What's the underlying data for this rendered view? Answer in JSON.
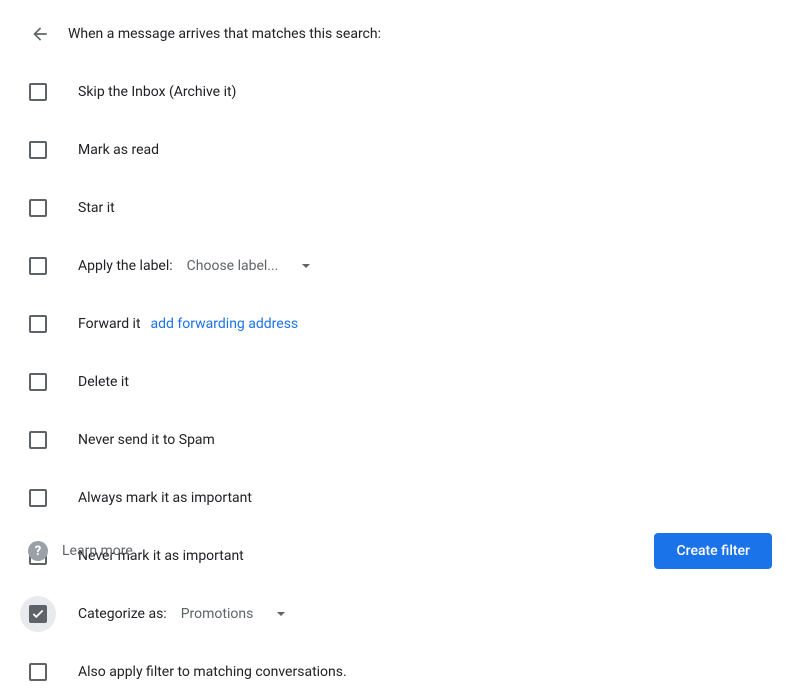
{
  "header": {
    "title": "When a message arrives that matches this search:"
  },
  "options": {
    "skip_inbox": {
      "label": "Skip the Inbox (Archive it)",
      "checked": false
    },
    "mark_read": {
      "label": "Mark as read",
      "checked": false
    },
    "star": {
      "label": "Star it",
      "checked": false
    },
    "apply_label": {
      "label": "Apply the label:",
      "dropdown": "Choose label...",
      "checked": false
    },
    "forward": {
      "label": "Forward it",
      "link": "add forwarding address",
      "checked": false
    },
    "delete": {
      "label": "Delete it",
      "checked": false
    },
    "never_spam": {
      "label": "Never send it to Spam",
      "checked": false
    },
    "always_important": {
      "label": "Always mark it as important",
      "checked": false
    },
    "never_important": {
      "label": "Never mark it as important",
      "checked": false
    },
    "categorize": {
      "label": "Categorize as:",
      "dropdown": "Promotions",
      "checked": true
    },
    "also_apply": {
      "label": "Also apply filter to matching conversations.",
      "checked": false
    }
  },
  "footer": {
    "learn_more": "Learn more",
    "create_button": "Create filter"
  }
}
